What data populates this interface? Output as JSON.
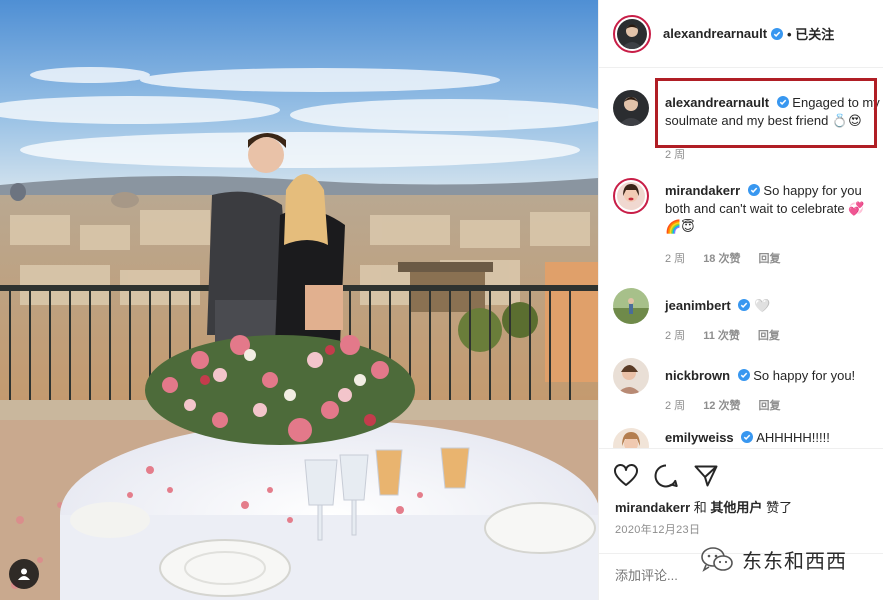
{
  "post": {
    "author": "alexandrearnault",
    "follow_status": "• 已关注",
    "caption": "Engaged to my soulmate and my best friend 💍😍",
    "caption_time": "2 周"
  },
  "comments": [
    {
      "user": "mirandakerr",
      "text": "So happy for you both and can't wait to celebrate 💞🌈😇",
      "time": "2 周",
      "likes": "18 次赞",
      "reply": "回复"
    },
    {
      "user": "jeanimbert",
      "text": "🤍",
      "time": "2 周",
      "likes": "11 次赞",
      "reply": "回复"
    },
    {
      "user": "nickbrown",
      "text": "So happy for you!",
      "time": "2 周",
      "likes": "12 次赞",
      "reply": "回复"
    },
    {
      "user": "emilyweiss",
      "text": "AHHHHH!!!!!"
    }
  ],
  "likes_line": {
    "user": "mirandakerr",
    "connector": "和",
    "others": "其他用户",
    "suffix": "赞了"
  },
  "date": "2020年12月23日",
  "comment_placeholder": "添加评论...",
  "watermark": "东东和西西",
  "colors": {
    "verified": "#3897f0",
    "highlight": "#b01e25",
    "story_ring": "#c81e47"
  },
  "icons": [
    "user-icon",
    "heart-icon",
    "comment-icon",
    "share-icon",
    "verified-icon",
    "wechat-icon"
  ]
}
